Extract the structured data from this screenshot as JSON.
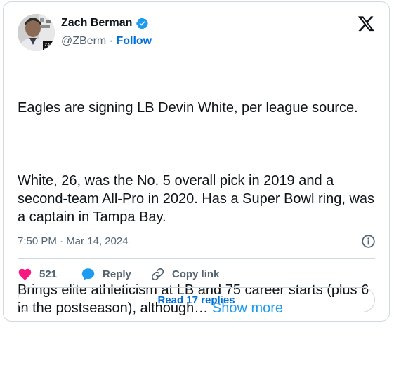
{
  "author": {
    "display_name": "Zach Berman",
    "handle": "@ZBerm",
    "separator": " · ",
    "follow_label": "Follow",
    "avatar_logo_text_1": "ZAC",
    "avatar_logo_text_2": "BERM"
  },
  "tweet": {
    "paragraph_1": "Eagles are signing LB Devin White, per league source.",
    "paragraph_2": "White, 26, was the No. 5 overall pick in 2019 and a second-team All-Pro in 2020. Has a Super Bowl ring, was a captain in Tampa Bay.",
    "paragraph_3": "Brings elite athleticism at LB and 75 career starts (plus 6 in the postseason), although…",
    "show_more_label": "Show more"
  },
  "meta": {
    "timestamp": "7:50 PM · Mar 14, 2024"
  },
  "actions": {
    "like_count": "521",
    "reply_label": "Reply",
    "copy_link_label": "Copy link"
  },
  "footer": {
    "read_replies_label": "Read 17 replies"
  },
  "colors": {
    "verified_blue": "#1d9bf0",
    "follow_blue": "#006fd6",
    "like_pink": "#f91880",
    "secondary_text": "#536471",
    "border": "#cfd9de"
  },
  "icons": {
    "verified": "verified-badge-icon",
    "brand": "x-logo-icon",
    "info": "info-icon",
    "like": "heart-icon",
    "reply": "speech-bubble-icon",
    "copy_link": "link-icon"
  }
}
